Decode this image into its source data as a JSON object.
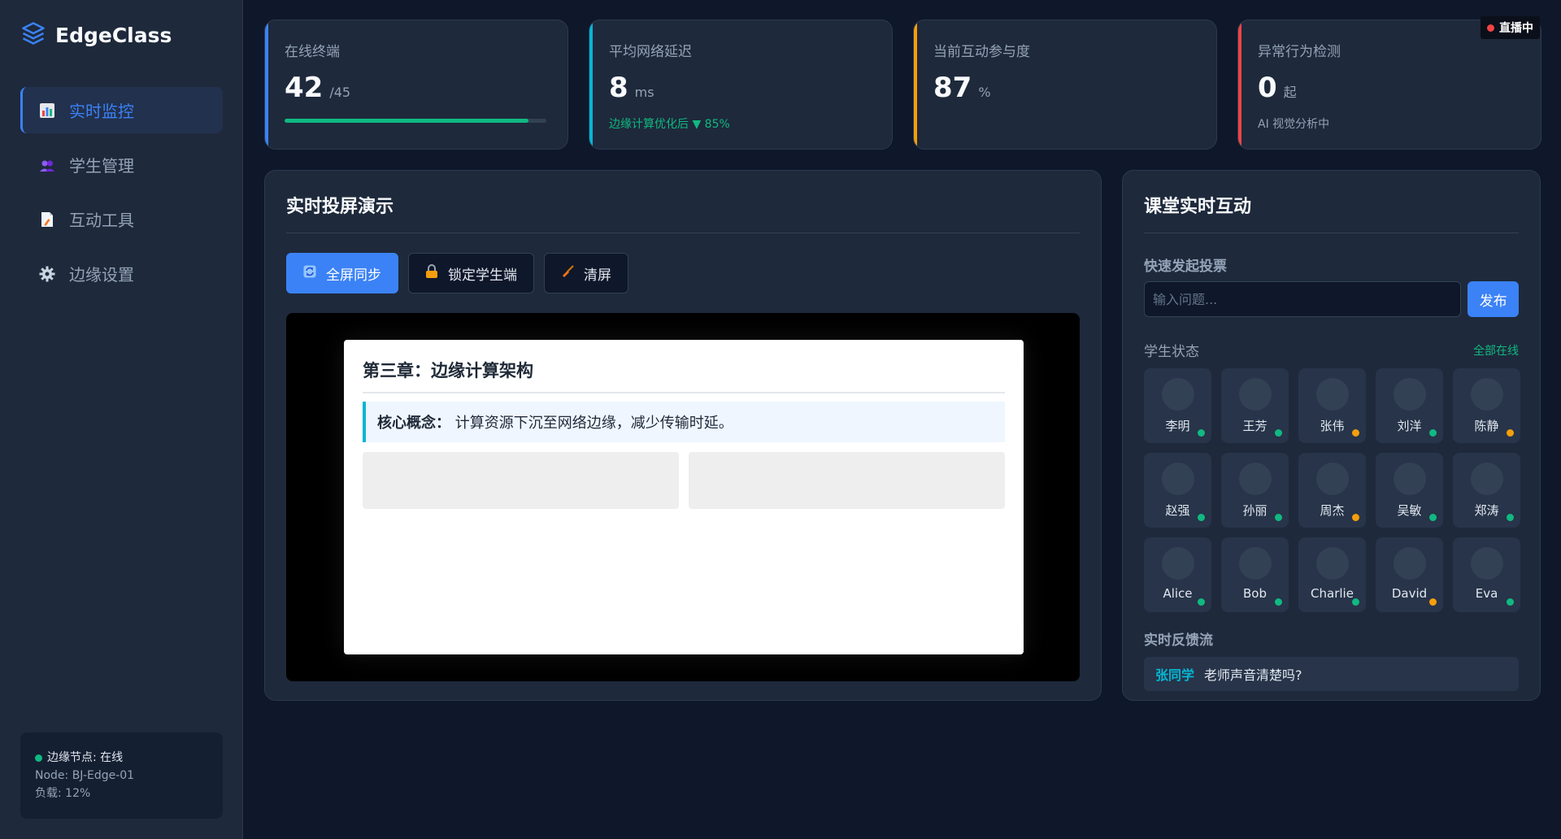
{
  "app": {
    "name": "EdgeClass",
    "live_badge": "直播中"
  },
  "sidebar": {
    "items": [
      {
        "label": "实时监控",
        "icon": "chart-icon",
        "active": true
      },
      {
        "label": "学生管理",
        "icon": "users-icon",
        "active": false
      },
      {
        "label": "互动工具",
        "icon": "document-icon",
        "active": false
      },
      {
        "label": "边缘设置",
        "icon": "gear-icon",
        "active": false
      }
    ],
    "node": {
      "status": "边缘节点: 在线",
      "node_id": "Node: BJ-Edge-01",
      "load": "负载: 12%"
    }
  },
  "stats": {
    "online": {
      "label": "在线终端",
      "value": "42",
      "unit": "/45",
      "progress_fraction": 0.933
    },
    "latency": {
      "label": "平均网络延迟",
      "value": "8",
      "unit": "ms",
      "sub": "边缘计算优化后 ▼ 85%"
    },
    "engagement": {
      "label": "当前互动参与度",
      "value": "87",
      "unit": "%"
    },
    "anomaly": {
      "label": "异常行为检测",
      "value": "0",
      "unit": "起",
      "sub": "AI 视觉分析中"
    }
  },
  "screen_panel": {
    "title": "实时投屏演示",
    "buttons": [
      {
        "label": "全屏同步",
        "icon": "sync-icon"
      },
      {
        "label": "锁定学生端",
        "icon": "lock-icon"
      },
      {
        "label": "清屏",
        "icon": "broom-icon"
      }
    ],
    "slide": {
      "title": "第三章：边缘计算架构",
      "concept_label": "核心概念：",
      "concept_text": "计算资源下沉至网络边缘，减少传输时延。"
    }
  },
  "interact_panel": {
    "title": "课堂实时互动",
    "vote_label": "快速发起投票",
    "vote_placeholder": "输入问题...",
    "publish": "发布",
    "status_label": "学生状态",
    "all_online": "全部在线",
    "students": [
      {
        "name": "李明",
        "status": "online"
      },
      {
        "name": "王芳",
        "status": "online"
      },
      {
        "name": "张伟",
        "status": "away"
      },
      {
        "name": "刘洋",
        "status": "online"
      },
      {
        "name": "陈静",
        "status": "away"
      },
      {
        "name": "赵强",
        "status": "online"
      },
      {
        "name": "孙丽",
        "status": "online"
      },
      {
        "name": "周杰",
        "status": "away"
      },
      {
        "name": "吴敏",
        "status": "online"
      },
      {
        "name": "郑涛",
        "status": "online"
      },
      {
        "name": "Alice",
        "status": "online"
      },
      {
        "name": "Bob",
        "status": "online"
      },
      {
        "name": "Charlie",
        "status": "online"
      },
      {
        "name": "David",
        "status": "away"
      },
      {
        "name": "Eva",
        "status": "online"
      }
    ],
    "feedback_label": "实时反馈流",
    "feedback": [
      {
        "user": "张同学",
        "text": "老师声音清楚吗?"
      }
    ]
  },
  "colors": {
    "online": "#10b981",
    "away": "#f59e0b",
    "accent": "#3b82f6"
  }
}
